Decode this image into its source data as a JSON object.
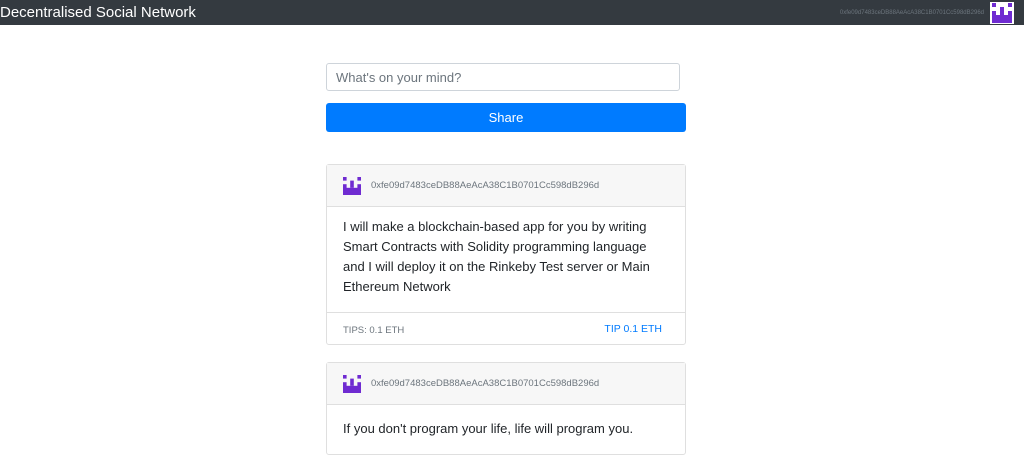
{
  "app": {
    "brand": "Decentralised Social Network",
    "account": "0xfe09d7483ceDB88AeAcA38C1B0701Cc598dB296d",
    "avatar_icon": "identicon",
    "colors": {
      "navbar": "#343a40",
      "accent": "#007bff",
      "identicon": "#6f2bd1"
    }
  },
  "composer": {
    "placeholder": "What's on your mind?",
    "share_label": "Share"
  },
  "posts": [
    {
      "author": "0xfe09d7483ceDB88AeAcA38C1B0701Cc598dB296d",
      "content": "I will make a blockchain-based app for you by writing Smart Contracts with Solidity programming language and I will deploy it on the Rinkeby Test server or Main Ethereum Network",
      "tips": "TIPS: 0.1 ETH",
      "tip_label": "TIP 0.1 ETH"
    },
    {
      "author": "0xfe09d7483ceDB88AeAcA38C1B0701Cc598dB296d",
      "content": "If you don't program your life, life will program you."
    }
  ]
}
